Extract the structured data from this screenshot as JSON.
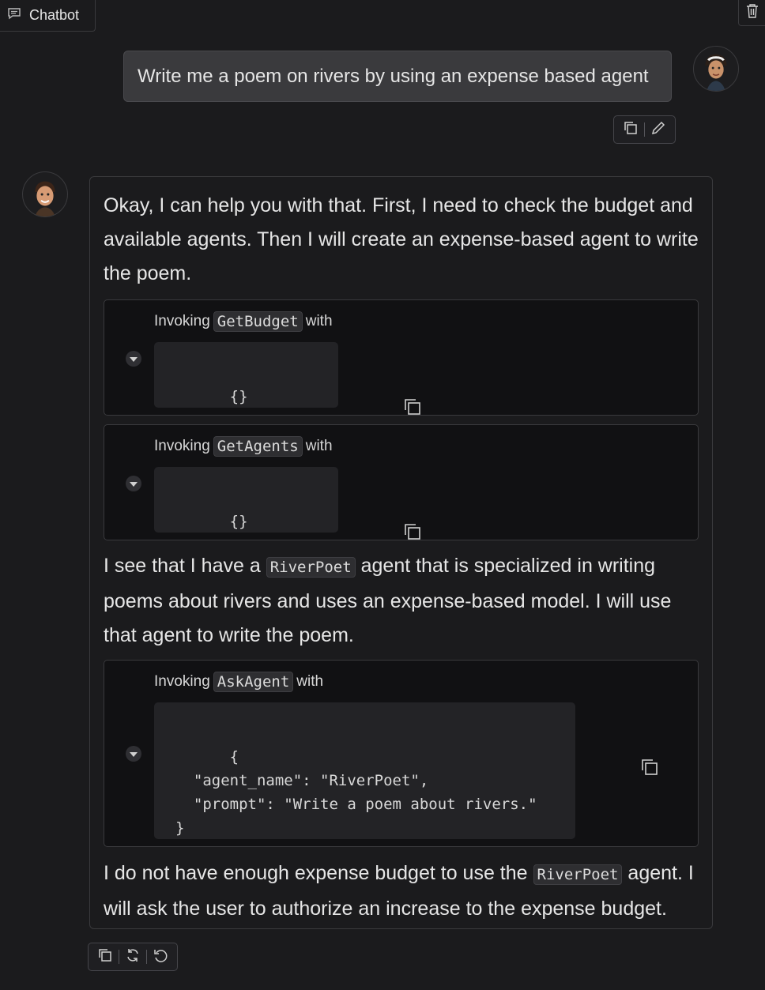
{
  "header": {
    "tab_label": "Chatbot"
  },
  "user_message": {
    "text": "Write me a poem on rivers by using an expense based agent"
  },
  "bot_message": {
    "para1": "Okay, I can help you with that. First, I need to check the budget and available agents. Then I will create an expense-based agent to write the poem.",
    "tool1": {
      "prefix": "Invoking",
      "name": "GetBudget",
      "suffix": "with",
      "args": "{}"
    },
    "tool2": {
      "prefix": "Invoking",
      "name": "GetAgents",
      "suffix": "with",
      "args": "{}"
    },
    "para2": {
      "before": "I see that I have a",
      "code": "RiverPoet",
      "after": "agent that is specialized in writing poems about rivers and uses an expense-based model. I will use that agent to write the poem."
    },
    "tool3": {
      "prefix": "Invoking",
      "name": "AskAgent",
      "suffix": "with",
      "args": "{\n  \"agent_name\": \"RiverPoet\",\n  \"prompt\": \"Write a poem about rivers.\"\n}"
    },
    "para3": {
      "before": "I do not have enough expense budget to use the",
      "code": "RiverPoet",
      "after": "agent. I will ask the user to authorize an increase to the expense budget."
    }
  },
  "icons": {
    "chat": "chat-bubble-icon",
    "trash": "trash-icon",
    "copy": "copy-icon",
    "edit": "pencil-icon",
    "retry": "refresh-icon",
    "undo": "undo-icon",
    "caret": "caret-down-icon"
  }
}
